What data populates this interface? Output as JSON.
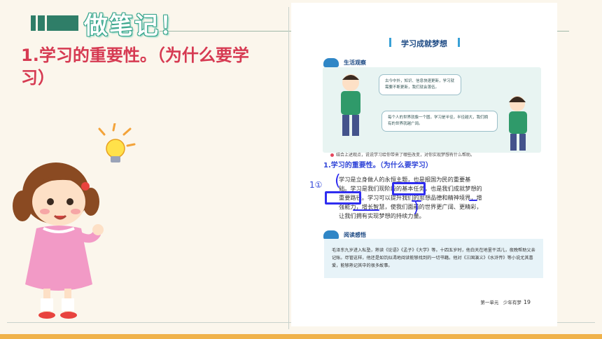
{
  "slide": {
    "banner_title": "做笔记！",
    "heading": "1.学习的重要性。（为什么要学习）"
  },
  "textbook": {
    "title": "学习成就梦想",
    "section_life": "生活观察",
    "bubble_1": "古今中外，知识、信息快速更新，学习就需要不断更新，我们就会落伍。",
    "bubble_2": "每个人的世界就像一个圆，学习是半径，半径越大，我们拥有的世界就越广阔。",
    "question": "结合上述观点，说说学习给你带来了哪些改变，对你实现梦想有什么帮助。",
    "sub_heading": "1.学习的重要性。（为什么要学习）",
    "annotation_number": "1①",
    "paragraph_lines": [
      "学习是立身做人的永恒主题，也是报国为民的重要基",
      "础。学习是我们现阶段的基本任务，也是我们成就梦想的",
      "重要路径。学习可以提升我们的思想品德和精神境界，增",
      "强能力，增长智慧，使我们面前的世界更广阔、更精彩，",
      "让我们拥有实现梦想的持续力量。"
    ],
    "section_read": "阅读感悟",
    "read_text": "毛泽东九岁进入私塾，熟读《论语》《孟子》《大学》等。十四五岁时，他白天在地里干活儿，夜晚帮助父亲记账。尽管这样，他还是如饥似渴地阅读能够找到的一切书籍。他对《三国演义》《水浒传》等小说尤其喜爱，能够熟记其中的很多故事。",
    "footer_unit": "第一单元　少年有梦",
    "footer_page": "19"
  }
}
